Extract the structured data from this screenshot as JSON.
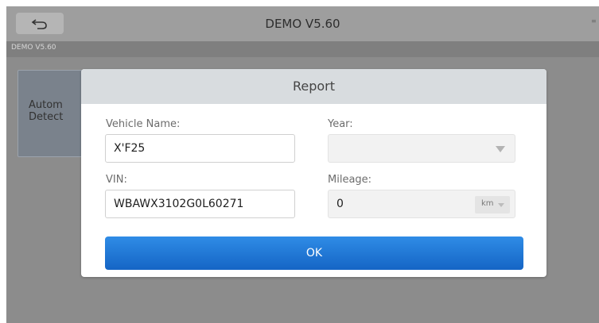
{
  "app": {
    "title": "DEMO V5.60",
    "breadcrumb": "DEMO V5.60",
    "back_icon": "back-arrow-icon"
  },
  "background_tile": {
    "line1": "Autom",
    "line2": "Detect"
  },
  "dialog": {
    "title": "Report",
    "vehicle_name": {
      "label": "Vehicle Name:",
      "value": "X'F25"
    },
    "year": {
      "label": "Year:",
      "value": ""
    },
    "vin": {
      "label": "VIN:",
      "value": "WBAWX3102G0L60271"
    },
    "mileage": {
      "label": "Mileage:",
      "value": "0",
      "unit": "km"
    },
    "ok_label": "OK"
  },
  "colors": {
    "primary_button": "#1f77d6",
    "dialog_header": "#d8dcdf",
    "overlay": "#8c8c8c"
  }
}
